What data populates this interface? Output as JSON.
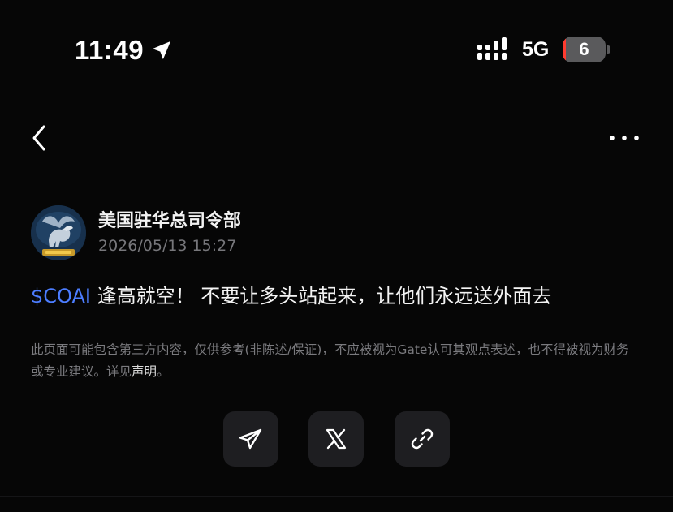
{
  "status_bar": {
    "time": "11:49",
    "network": "5G",
    "battery_level": "6",
    "battery_low_color": "#ff3b30"
  },
  "nav": {
    "back_icon": "chevron-left-icon",
    "more_icon": "ellipsis-icon"
  },
  "post": {
    "author": "美国驻华总司令部",
    "timestamp": "2026/05/13 15:27",
    "ticker": "$COAI",
    "content": " 逢高就空！ 不要让多头站起来，让他们永远送外面去"
  },
  "disclaimer": {
    "text": "此页面可能包含第三方内容，仅供参考(非陈述/保证)，不应被视为Gate认可其观点表述，也不得被视为财务或专业建议。详见",
    "link_label": "声明",
    "suffix": "。"
  },
  "share": {
    "buttons": [
      {
        "icon": "telegram-icon"
      },
      {
        "icon": "x-logo-icon"
      },
      {
        "icon": "link-icon"
      }
    ]
  },
  "colors": {
    "background": "#060606",
    "accent_link": "#4c7dff",
    "muted_text": "#77777b",
    "button_bg": "#1e1e21"
  }
}
